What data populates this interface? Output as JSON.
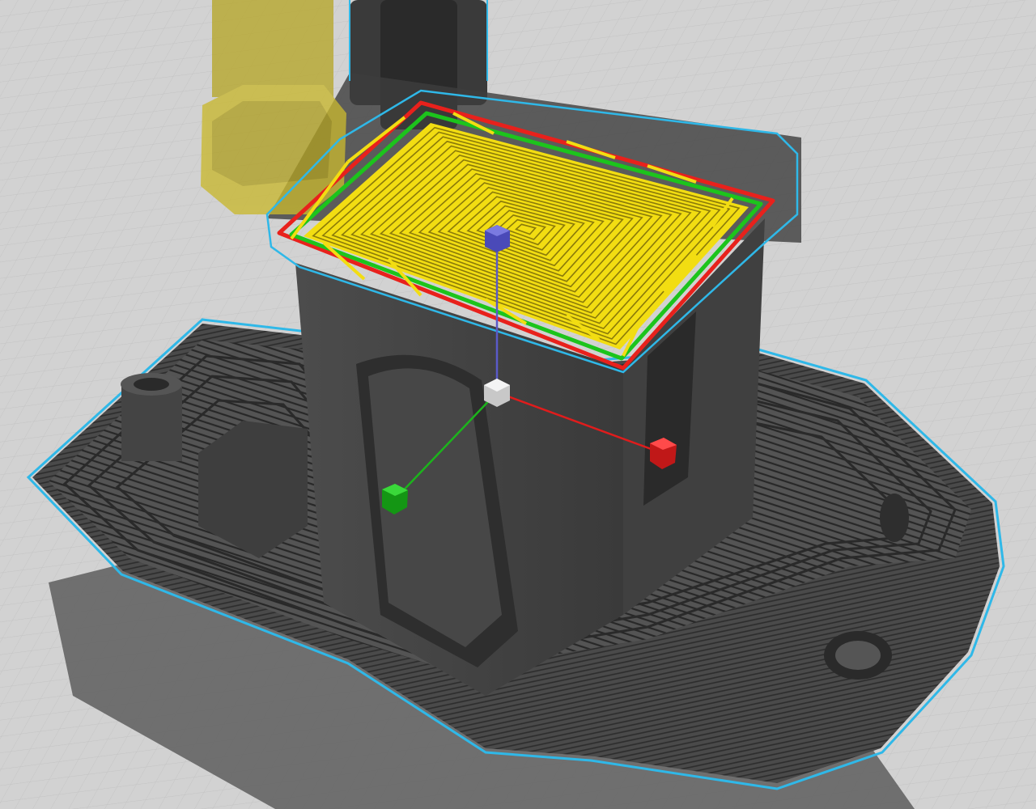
{
  "viewport": {
    "view": "3d-print-preview",
    "model_name": "",
    "background_color": "#d2d2d2",
    "grid_color": "#c6c6c6",
    "model_color": "#4a4a4a",
    "model_edge_color": "#2e2e2e",
    "shadow_color": "#5a5a5a",
    "selection_outline_color": "#2fb8e8"
  },
  "toolhead": {
    "nozzle_color": "#c9b830",
    "nozzle_shadow_color": "#9e8d1a",
    "carriage_color": "#3a3a3a"
  },
  "current_layer": {
    "outer_wall_color": "#e8211c",
    "inner_wall_color": "#1cc41c",
    "infill_color": "#f2dd12",
    "infill_pattern": "concentric"
  },
  "gizmo": {
    "x_axis_color": "#e01c1c",
    "y_axis_color": "#1cb41c",
    "z_axis_color": "#5a5ac8",
    "center_color": "#e8e8e8",
    "icons": [
      "x-axis-handle",
      "y-axis-handle",
      "z-axis-handle",
      "gizmo-center-handle"
    ]
  }
}
